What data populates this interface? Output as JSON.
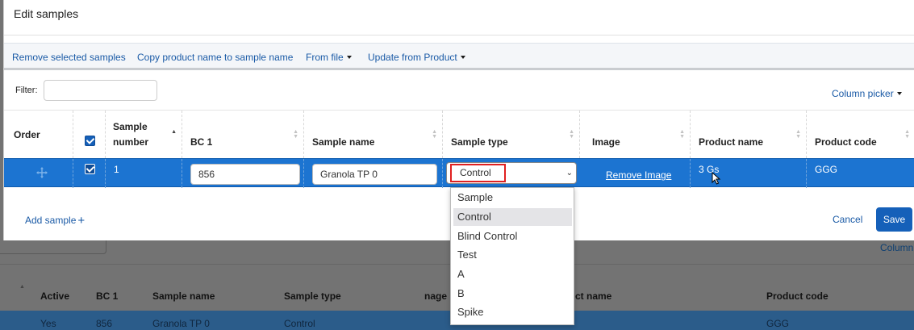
{
  "modal": {
    "title": "Edit samples",
    "toolbar": {
      "remove_selected": "Remove selected samples",
      "copy_product_name": "Copy product name to sample name",
      "from_file": "From file",
      "update_from_product": "Update from Product"
    },
    "filter_label": "Filter:",
    "filter_value": "",
    "column_picker": "Column picker",
    "columns": {
      "order": "Order",
      "sample_number_l1": "Sample",
      "sample_number_l2": "number",
      "bc1": "BC 1",
      "sample_name": "Sample name",
      "sample_type": "Sample type",
      "image": "Image",
      "product_name": "Product name",
      "product_code": "Product code"
    },
    "row": {
      "sample_number": "1",
      "bc1": "856",
      "sample_name": "Granola TP 0",
      "sample_type": "Control",
      "image_action": "Remove Image",
      "product_name": "3 Gs",
      "product_code": "GGG"
    },
    "footer": {
      "add_sample": "Add sample",
      "cancel": "Cancel",
      "save": "Save"
    }
  },
  "sample_type_options": [
    "Sample",
    "Control",
    "Blind Control",
    "Test",
    "A",
    "B",
    "Spike"
  ],
  "selected_option": "Control",
  "background_table": {
    "column_picker": "Column",
    "headers": {
      "active": "Active",
      "bc1": "BC 1",
      "sample_name": "Sample name",
      "sample_type": "Sample type",
      "image_partial": "nage",
      "product_name_partial": "ct name",
      "product_code": "Product code"
    },
    "row": {
      "active": "Yes",
      "bc1": "856",
      "sample_name": "Granola TP 0",
      "sample_type": "Control",
      "product_code": "GGG"
    }
  },
  "colors": {
    "accent": "#1560b9",
    "selected_row": "#1c74d1",
    "link": "#1a5aa6",
    "highlight_border": "#e02020"
  }
}
